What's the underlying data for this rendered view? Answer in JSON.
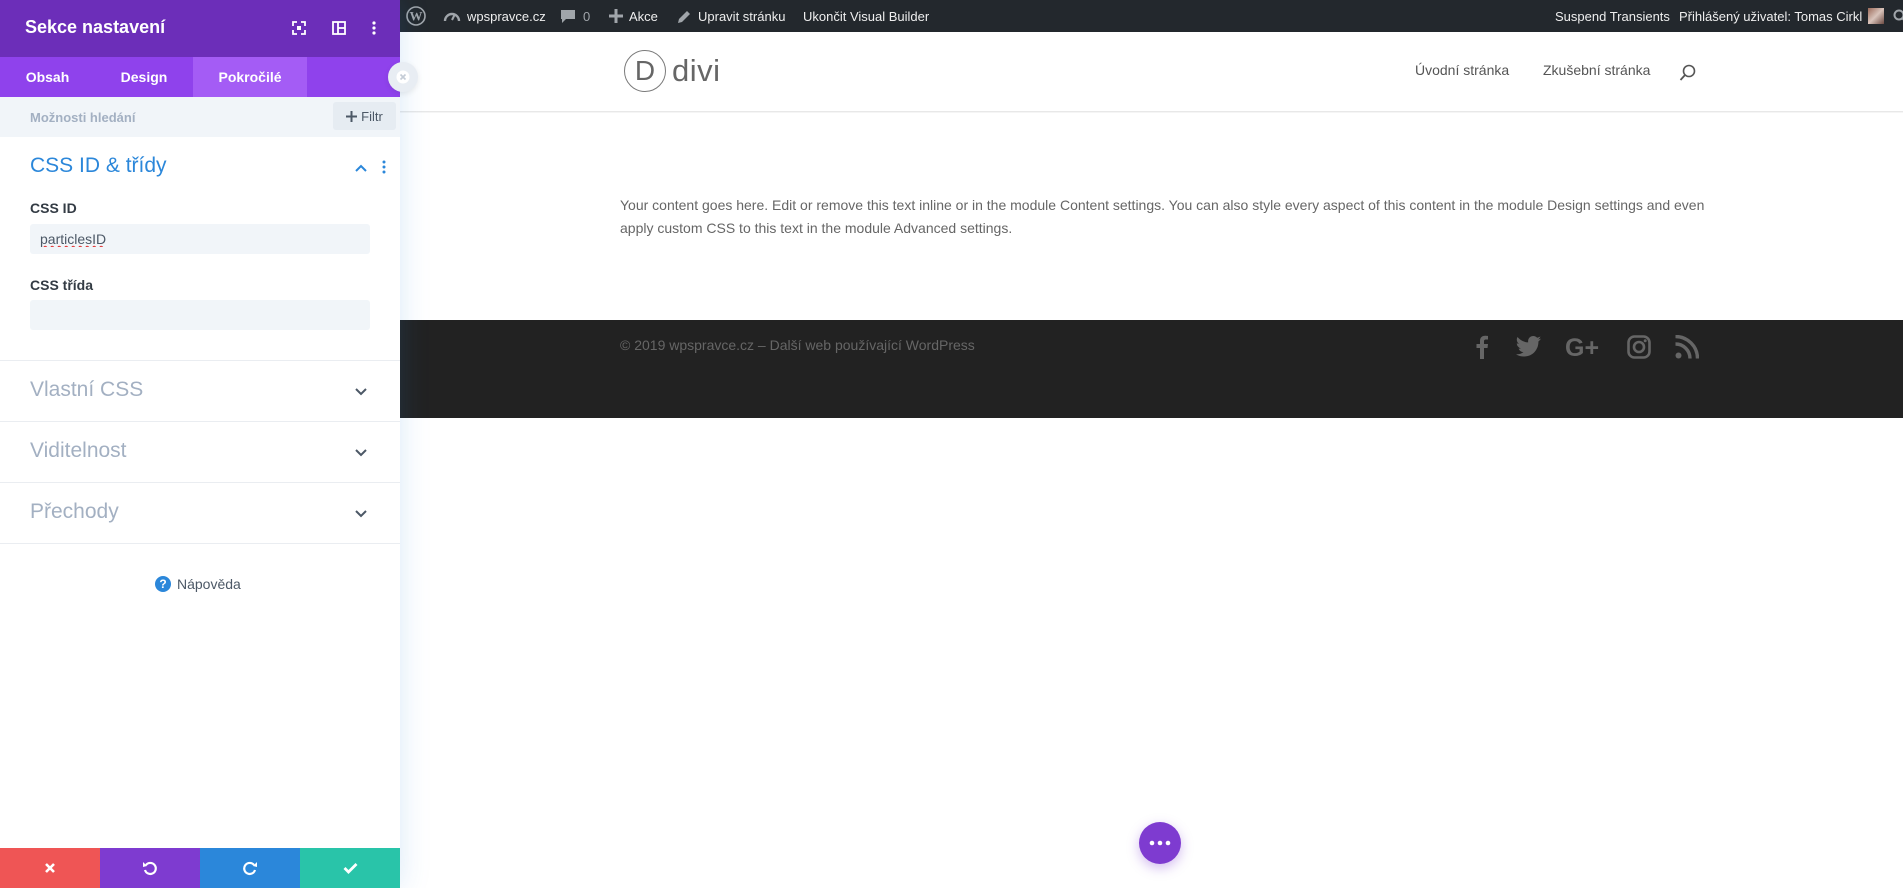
{
  "adminbar": {
    "site_name": "wpspravce.cz",
    "comments_count": "0",
    "new_label": "Akce",
    "edit_label": "Upravit stránku",
    "exit_label": "Ukončit Visual Builder",
    "suspend_label": "Suspend Transients",
    "user_label": "Přihlášený uživatel: Tomas Cirkl"
  },
  "panel": {
    "title": "Sekce nastavení",
    "tabs": [
      {
        "label": "Obsah"
      },
      {
        "label": "Design"
      },
      {
        "label": "Pokročilé"
      }
    ],
    "active_tab": "Pokročilé",
    "search_placeholder": "Možnosti hledání",
    "filter_label": "Filtr",
    "sections": {
      "css": {
        "title": "CSS ID & třídy",
        "id_label": "CSS ID",
        "id_value": "particlesID",
        "class_label": "CSS třída",
        "class_value": ""
      },
      "custom_css": "Vlastní CSS",
      "visibility": "Viditelnost",
      "transitions": "Přechody"
    },
    "help_label": "Nápověda",
    "footer_colors": {
      "discard": "#ef5555",
      "undo": "#7e3bd0",
      "redo": "#2b87da",
      "save": "#29c4a9"
    }
  },
  "site": {
    "logo_letter": "D",
    "logo_text": "divi",
    "nav": [
      "Úvodní stránka",
      "Zkušební stránka"
    ],
    "body_text": "Your content goes here. Edit or remove this text inline or in the module Content settings. You can also style every aspect of this content in the module Design settings and even apply custom CSS to this text in the module Advanced settings.",
    "copyright": "© 2019 wpspravce.cz – Další web používající WordPress",
    "social_icons": [
      "facebook-icon",
      "twitter-icon",
      "google-plus-icon",
      "instagram-icon",
      "rss-icon"
    ]
  },
  "colors": {
    "panel_header": "#6c2eb9",
    "panel_tabs": "#8f42ec",
    "accent_blue": "#2b87da",
    "adminbar_bg": "#23282d",
    "footer_bg": "#222222"
  }
}
